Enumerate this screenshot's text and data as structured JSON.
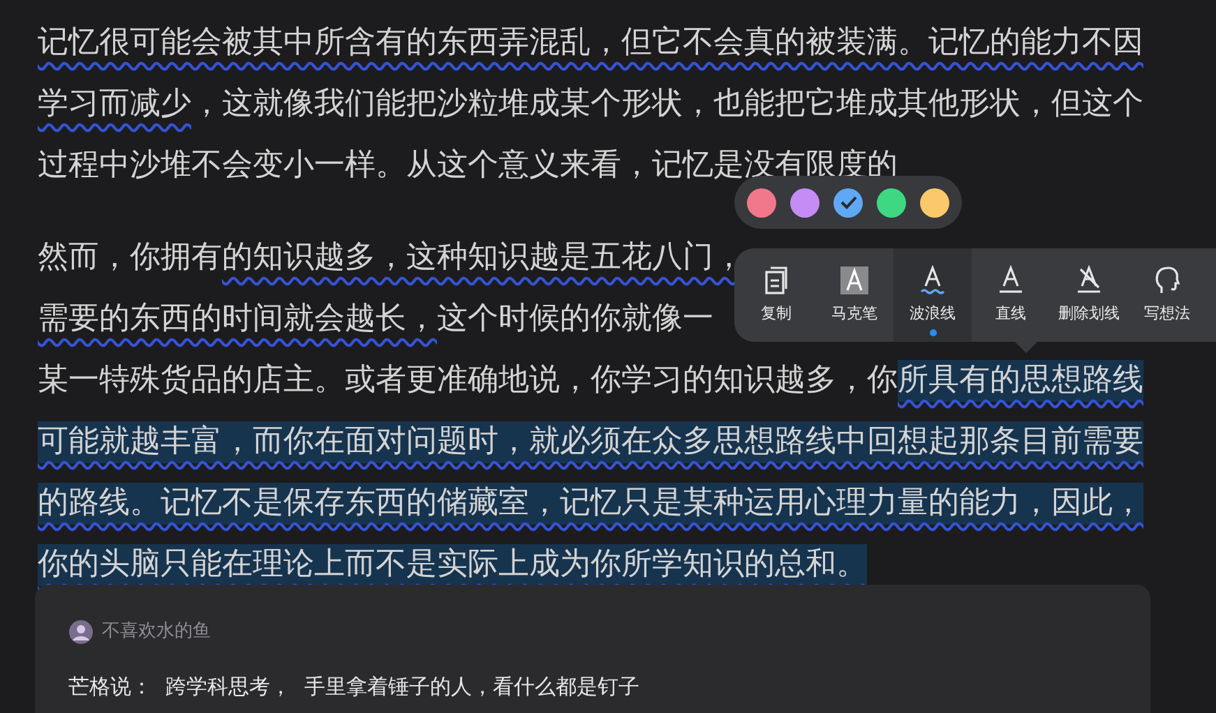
{
  "paragraphs": [
    {
      "lines": [
        {
          "segments": [
            {
              "text": "记忆很可能会被其中所含有的东西弄混乱，但它不会真的被装满。记忆的能力不因",
              "wavy": true,
              "highlight": false
            }
          ]
        },
        {
          "segments": [
            {
              "text": "学习而减少",
              "wavy": true,
              "highlight": false
            },
            {
              "text": "，这就像我们能把沙粒堆成某个形状，也能把它堆成其他形状，但这个",
              "wavy": false,
              "highlight": false
            }
          ]
        },
        {
          "segments": [
            {
              "text": "过程中沙堆不会变小一样。从这个意义来看，记忆是没有限度的",
              "wavy": false,
              "highlight": false
            }
          ]
        }
      ]
    },
    {
      "lines": [
        {
          "segments": [
            {
              "text": "然而，你拥有",
              "wavy": false,
              "highlight": false
            },
            {
              "text": "的知识越多，这种知识越是五花八门，",
              "wavy": true,
              "highlight": false
            }
          ]
        },
        {
          "segments": [
            {
              "text": "需要的东西的时间就会越长，",
              "wavy": true,
              "highlight": false
            },
            {
              "text": "这个时候的你就像一",
              "wavy": false,
              "highlight": false
            }
          ]
        },
        {
          "segments": [
            {
              "text": "某一特殊货品的店主。或者更准确地说，你学习的知识越多，你",
              "wavy": false,
              "highlight": false
            },
            {
              "text": "所具有的思想路线",
              "wavy": true,
              "highlight": true
            }
          ]
        },
        {
          "segments": [
            {
              "text": "可能就越丰富，而你在面对问题时，就必须在众多思想路线中回想起那条目前需要",
              "wavy": true,
              "highlight": true
            }
          ]
        },
        {
          "segments": [
            {
              "text": "的路线。记忆不是保存东西的储藏室，记忆只是某种运用心理力量的能力，因此，",
              "wavy": true,
              "highlight": true
            }
          ]
        },
        {
          "segments": [
            {
              "text": "你的头脑只能在理论上而不是实际上成为你所学知识的总和。",
              "wavy": true,
              "highlight": true
            }
          ]
        }
      ]
    }
  ],
  "color_picker": {
    "colors": [
      {
        "color": "#f0788a",
        "selected": false
      },
      {
        "color": "#c58cf5",
        "selected": false
      },
      {
        "color": "#5ea8f5",
        "selected": true
      },
      {
        "color": "#3ed882",
        "selected": false
      },
      {
        "color": "#fcc86c",
        "selected": false
      }
    ]
  },
  "toolbar": {
    "tools": [
      {
        "label": "复制",
        "kind": "copy",
        "selected": false
      },
      {
        "label": "马克笔",
        "kind": "marker",
        "selected": false
      },
      {
        "label": "波浪线",
        "kind": "wavy",
        "selected": true
      },
      {
        "label": "直线",
        "kind": "straight",
        "selected": false
      },
      {
        "label": "删除划线",
        "kind": "erase",
        "selected": false
      },
      {
        "label": "写想法",
        "kind": "note",
        "selected": false
      }
    ]
  },
  "note_card": {
    "author": "不喜欢水的鱼",
    "quote": "芒格说：  跨学科思考，  手里拿着锤子的人，看什么都是钉子"
  }
}
